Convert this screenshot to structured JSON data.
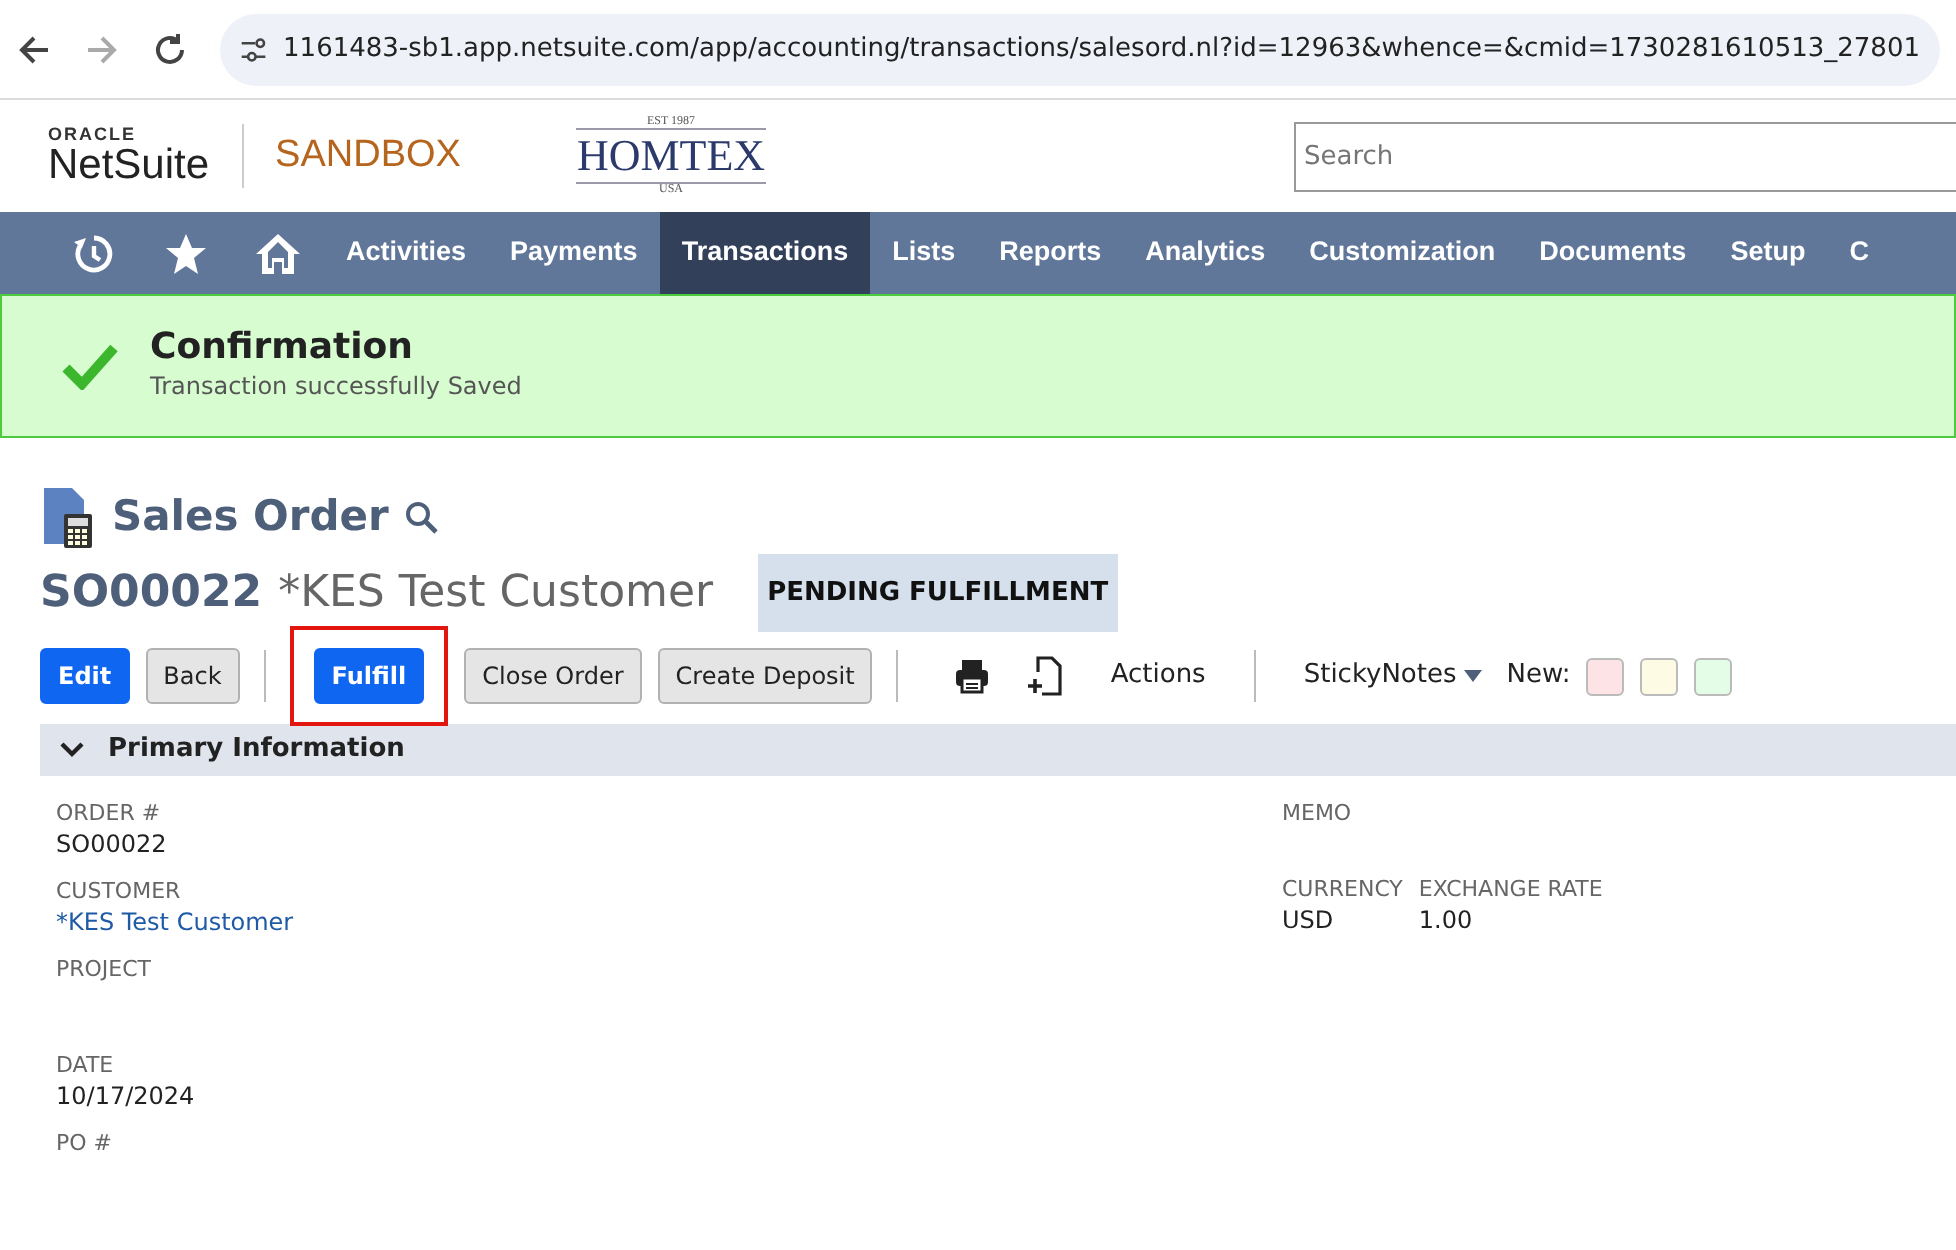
{
  "browser": {
    "url": "1161483-sb1.app.netsuite.com/app/accounting/transactions/salesord.nl?id=12963&whence=&cmid=1730281610513_27801"
  },
  "header": {
    "logo_top": "ORACLE",
    "logo_main": "NetSuite",
    "environment": "SANDBOX",
    "company_top": "EST 1987",
    "company_name": "HOMTEX",
    "company_bottom": "USA",
    "search": {
      "placeholder": "Search"
    }
  },
  "nav": [
    {
      "label": "Activities",
      "selected": false
    },
    {
      "label": "Payments",
      "selected": false
    },
    {
      "label": "Transactions",
      "selected": true
    },
    {
      "label": "Lists",
      "selected": false
    },
    {
      "label": "Reports",
      "selected": false
    },
    {
      "label": "Analytics",
      "selected": false
    },
    {
      "label": "Customization",
      "selected": false
    },
    {
      "label": "Documents",
      "selected": false
    },
    {
      "label": "Setup",
      "selected": false
    },
    {
      "label": "C",
      "selected": false
    }
  ],
  "confirmation": {
    "title": "Confirmation",
    "message": "Transaction successfully Saved"
  },
  "page": {
    "title": "Sales Order",
    "number": "SO00022",
    "customer": "*KES Test Customer",
    "status": "PENDING FULFILLMENT"
  },
  "buttons": [
    {
      "label": "Edit",
      "kind": "primary",
      "highlighted": false
    },
    {
      "label": "Back",
      "kind": "secondary",
      "highlighted": false
    },
    {
      "label": "Fulfill",
      "kind": "primary",
      "highlighted": true
    },
    {
      "label": "Close Order",
      "kind": "secondary",
      "highlighted": false
    },
    {
      "label": "Create Deposit",
      "kind": "secondary",
      "highlighted": false
    }
  ],
  "actions": "Actions",
  "sticky_notes": "StickyNotes",
  "new_label": "New:",
  "note_colors": [
    {
      "color": "#fde3e6"
    },
    {
      "color": "#fdfbe3"
    },
    {
      "color": "#e3fde6"
    }
  ],
  "section": {
    "title": "Primary Information",
    "expanded": true
  },
  "left_fields": [
    {
      "label": "ORDER #",
      "value": "SO00022",
      "kind": "text"
    },
    {
      "label": "CUSTOMER",
      "value": "*KES Test Customer",
      "kind": "link"
    },
    {
      "label": "PROJECT",
      "kind": "text"
    },
    {
      "label": "DATE",
      "value": "10/17/2024",
      "kind": "text"
    },
    {
      "label": "PO #",
      "kind": "text"
    }
  ],
  "right_fields": [
    {
      "label": "MEMO"
    }
  ],
  "right_pair": [
    {
      "label": "CURRENCY",
      "value": "USD"
    },
    {
      "label": "EXCHANGE RATE",
      "value": "1.00"
    }
  ]
}
